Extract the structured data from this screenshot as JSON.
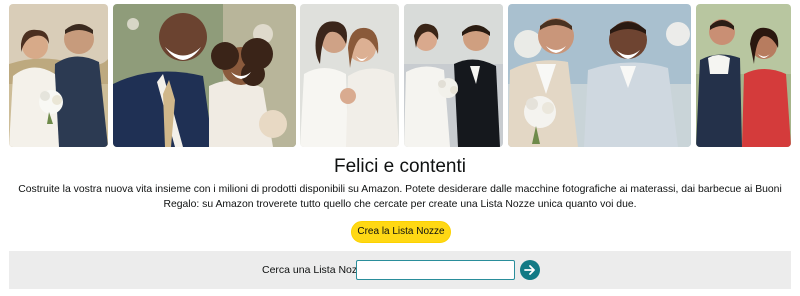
{
  "photos": [
    {
      "name": "photo-couple-field",
      "icon": "bride-groom-photo"
    },
    {
      "name": "photo-couple-laughing",
      "icon": "bride-groom-photo"
    },
    {
      "name": "photo-brides-embracing",
      "icon": "bride-bride-photo"
    },
    {
      "name": "photo-couple-formal",
      "icon": "bride-groom-photo"
    },
    {
      "name": "photo-grooms-walking",
      "icon": "groom-groom-photo"
    },
    {
      "name": "photo-couple-red-dress",
      "icon": "bride-groom-photo"
    }
  ],
  "hero": {
    "title": "Felici e contenti",
    "description": "Costruite la vostra nuova vita insieme con i milioni di prodotti disponibili su Amazon. Potete desiderare dalle macchine fotografiche ai materassi, dai barbecue ai Buoni Regalo: su Amazon troverete tutto quello che cercate per create una Lista Nozze unica quanto voi due.",
    "cta_label": "Crea la Lista Nozze"
  },
  "search": {
    "label": "Cerca una Lista Nozze",
    "value": "",
    "go_icon": "arrow-right-icon"
  },
  "colors": {
    "cta": "#ffd814",
    "search_band": "#ececec",
    "input_border": "#2a8e9b",
    "go_button": "#127a85"
  }
}
